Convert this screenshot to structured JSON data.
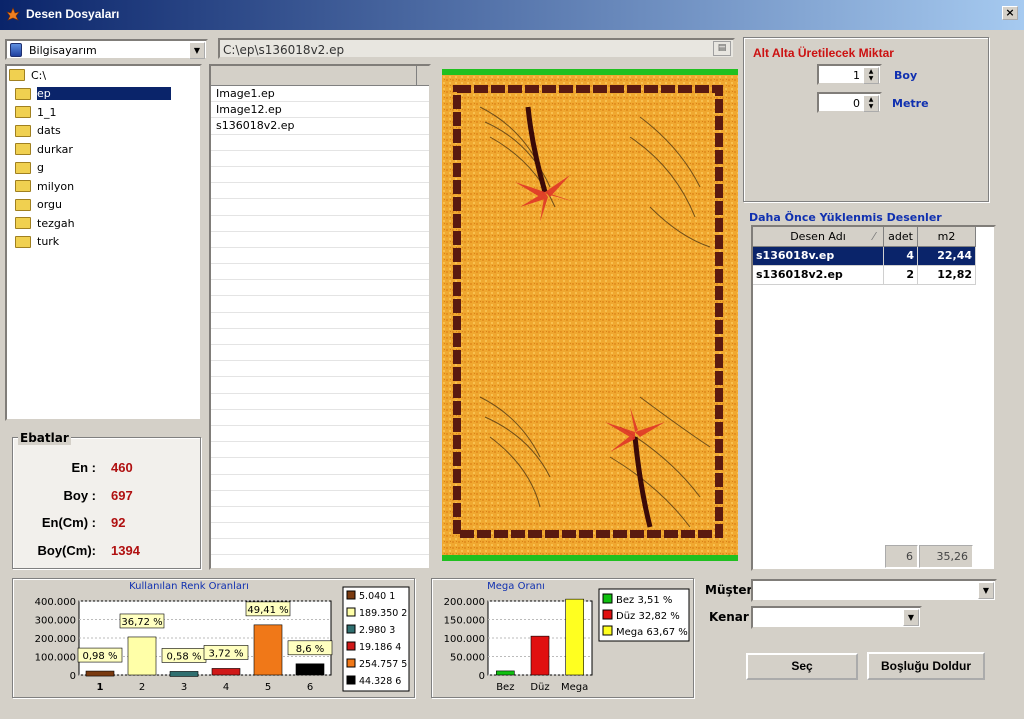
{
  "window": {
    "title": "Desen Dosyaları",
    "close_label": "×"
  },
  "drive": {
    "selected": "Bilgisayarım"
  },
  "path": {
    "value": "C:\\ep\\s136018v2.ep"
  },
  "tree": {
    "items": [
      {
        "label": "C:\\",
        "level": 0,
        "selected": false
      },
      {
        "label": "ep",
        "level": 1,
        "selected": true
      },
      {
        "label": "1_1",
        "level": 1,
        "selected": false
      },
      {
        "label": "dats",
        "level": 1,
        "selected": false
      },
      {
        "label": "durkar",
        "level": 1,
        "selected": false
      },
      {
        "label": "g",
        "level": 1,
        "selected": false
      },
      {
        "label": "milyon",
        "level": 1,
        "selected": false
      },
      {
        "label": "orgu",
        "level": 1,
        "selected": false
      },
      {
        "label": "tezgah",
        "level": 1,
        "selected": false
      },
      {
        "label": "turk",
        "level": 1,
        "selected": false
      }
    ]
  },
  "files": {
    "items": [
      "Image1.ep",
      "Image12.ep",
      "s136018v2.ep"
    ]
  },
  "ebatlar": {
    "title": "Ebatlar",
    "rows": [
      {
        "label": "En :",
        "value": "460"
      },
      {
        "label": "Boy :",
        "value": "697"
      },
      {
        "label": "En(Cm) :",
        "value": "92"
      },
      {
        "label": "Boy(Cm):",
        "value": "1394"
      }
    ]
  },
  "production": {
    "title": "Alt Alta Üretilecek Miktar",
    "boy_value": "1",
    "boy_label": "Boy",
    "metre_value": "0",
    "metre_label": "Metre"
  },
  "loaded": {
    "title": "Daha Önce Yüklenmis Desenler",
    "headers": [
      "Desen Adı",
      "adet",
      "m2"
    ],
    "rows": [
      {
        "name": "s136018v.ep",
        "adet": "4",
        "m2": "22,44",
        "selected": true
      },
      {
        "name": "s136018v2.ep",
        "adet": "2",
        "m2": "12,82",
        "selected": false
      }
    ],
    "total_adet": "6",
    "total_m2": "35,26"
  },
  "customer": {
    "musteri_label": "Müşteri",
    "musteri_value": "",
    "kenar_label": "Kenar",
    "kenar_value": ""
  },
  "buttons": {
    "sec": "Seç",
    "fill": "Boşluğu Doldur"
  },
  "colors": {
    "accent_red": "#cc1111",
    "accent_blue": "#1030b0",
    "selection": "#0a246a"
  },
  "chart_data": [
    {
      "type": "bar",
      "title": "Kullanılan Renk Oranları",
      "categories": [
        "1",
        "2",
        "3",
        "4",
        "5",
        "6"
      ],
      "values": [
        5040,
        189350,
        2980,
        19186,
        254757,
        44328
      ],
      "data_labels": [
        "0,98 %",
        "36,72 %",
        "0,58 %",
        "3,72 %",
        "49,41 %",
        "8,6 %"
      ],
      "colors": [
        "#7a3a10",
        "#ffffa8",
        "#2f6f70",
        "#d01818",
        "#f07818",
        "#000000"
      ],
      "yticks": [
        "0",
        "100.000",
        "200.000",
        "300.000",
        "400.000"
      ],
      "ylim": [
        0,
        400000
      ],
      "legend": [
        "5.040 1",
        "189.350 2",
        "2.980 3",
        "19.186 4",
        "254.757 5",
        "44.328 6"
      ],
      "grid": true,
      "legend_position": "right"
    },
    {
      "type": "bar",
      "title": "Mega Oranı",
      "categories": [
        "Bez",
        "Düz",
        "Mega"
      ],
      "values": [
        3.51,
        32.82,
        63.67
      ],
      "colors": [
        "#10c010",
        "#e01010",
        "#ffff20"
      ],
      "yticks": [
        "0",
        "50.000",
        "100.000",
        "150.000",
        "200.000"
      ],
      "ylim": [
        0,
        200000
      ],
      "bar_values": [
        11000,
        105000,
        205000
      ],
      "legend": [
        "Bez 3,51 %",
        "Düz 32,82 %",
        "Mega 63,67 %"
      ],
      "grid": true,
      "legend_position": "right"
    }
  ]
}
